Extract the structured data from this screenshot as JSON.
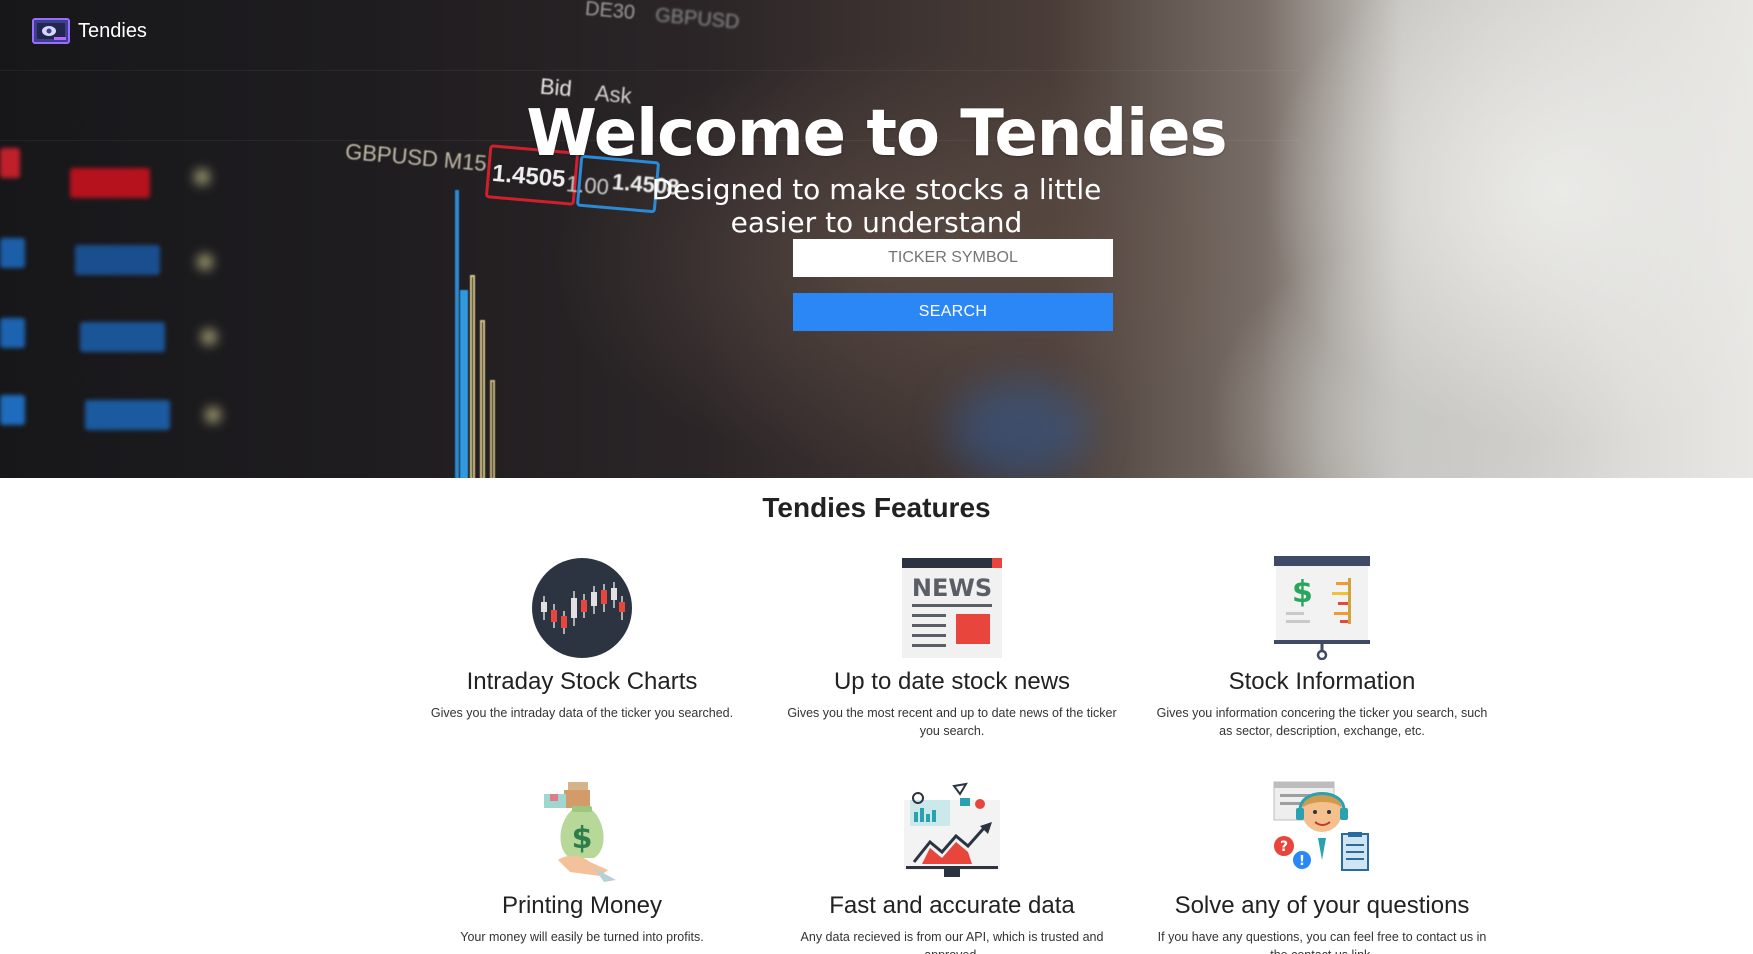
{
  "brand": {
    "name": "Tendies"
  },
  "hero": {
    "title": "Welcome to Tendies",
    "subtitle": "Designed to make stocks a little easier to understand",
    "background_text": [
      "GBPUSD M15",
      "1.4505",
      "1.00",
      "1.4508",
      "Bid",
      "Ask",
      "DE30",
      "GBPUSD"
    ]
  },
  "search": {
    "placeholder": "TICKER SYMBOL",
    "value": "",
    "button_label": "SEARCH",
    "button_color": "#2a87f5"
  },
  "features": {
    "title": "Tendies Features",
    "items": [
      {
        "icon": "candlestick-chart-icon",
        "title": "Intraday Stock Charts",
        "description": "Gives you the intraday data of the ticker you searched."
      },
      {
        "icon": "newspaper-icon",
        "title": "Up to date stock news",
        "description": "Gives you the most recent and up to date news of the ticker you search."
      },
      {
        "icon": "presentation-board-icon",
        "title": "Stock Information",
        "description": "Gives you information concering the ticker you search, such as sector, description, exchange, etc."
      },
      {
        "icon": "money-bag-icon",
        "title": "Printing Money",
        "description": "Your money will easily be turned into profits."
      },
      {
        "icon": "analytics-monitor-icon",
        "title": "Fast and accurate data",
        "description": "Any data recieved is from our API, which is trusted and approved."
      },
      {
        "icon": "support-agent-icon",
        "title": "Solve any of your questions",
        "description": "If you have any questions, you can feel free to contact us in the contact us link."
      }
    ]
  }
}
